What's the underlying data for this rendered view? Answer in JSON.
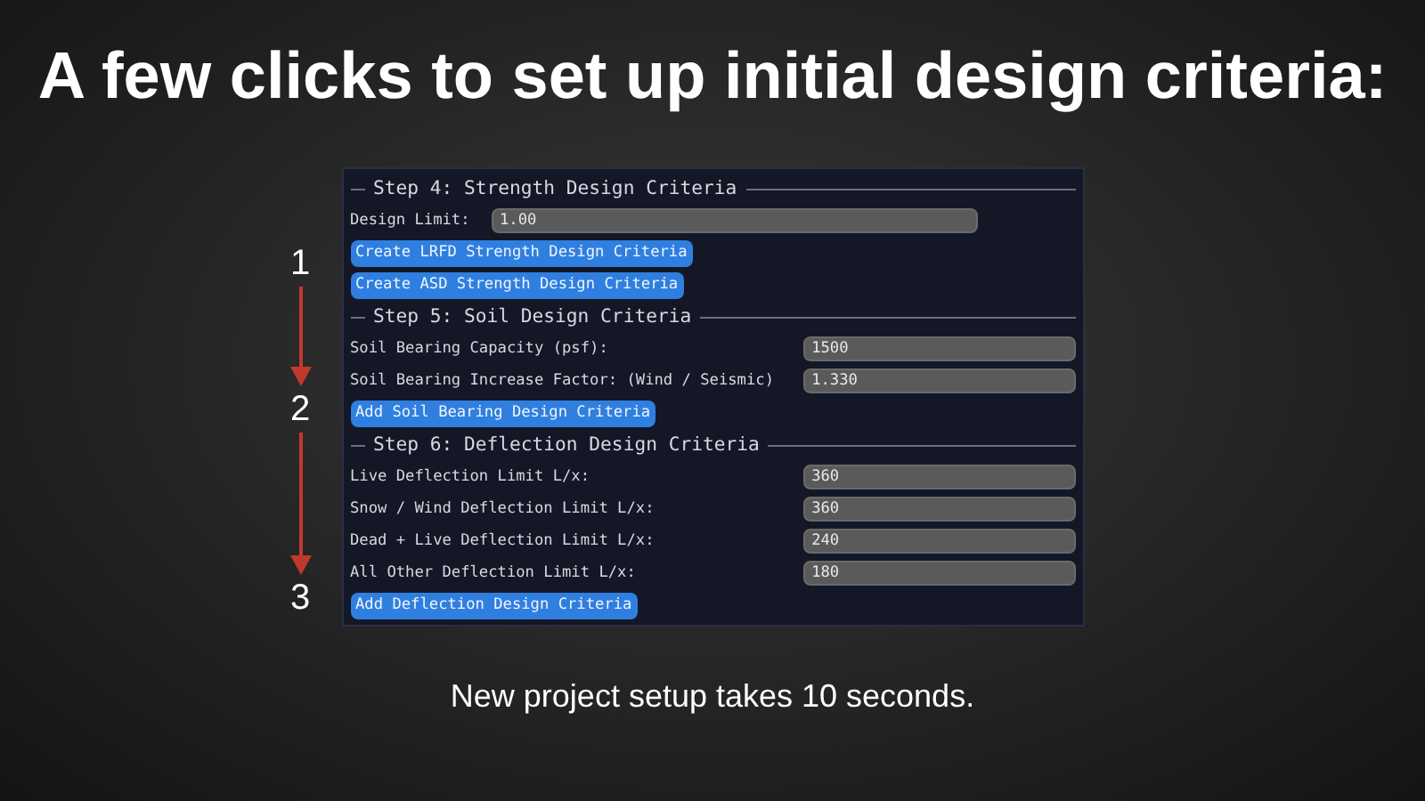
{
  "title": "A few clicks to set up initial design criteria:",
  "markers": [
    {
      "label": "1"
    },
    {
      "label": "2"
    },
    {
      "label": "3"
    }
  ],
  "panel": {
    "sections": [
      {
        "heading": "Step 4: Strength Design Criteria",
        "fields": [
          {
            "kind": "inline",
            "label": "Design Limit:",
            "value": "1.00"
          }
        ],
        "buttons": [
          "Create LRFD Strength Design Criteria",
          "Create ASD Strength Design Criteria"
        ]
      },
      {
        "heading": "Step 5: Soil Design Criteria",
        "fields": [
          {
            "kind": "aligned",
            "label": "Soil Bearing Capacity (psf):",
            "value": "1500"
          },
          {
            "kind": "aligned",
            "label": "Soil Bearing Increase Factor: (Wind / Seismic)",
            "value": "1.330"
          }
        ],
        "buttons": [
          "Add Soil Bearing Design Criteria"
        ]
      },
      {
        "heading": "Step 6: Deflection Design Criteria",
        "fields": [
          {
            "kind": "aligned",
            "label": "Live Deflection Limit L/x:",
            "value": "360"
          },
          {
            "kind": "aligned",
            "label": "Snow / Wind Deflection Limit L/x:",
            "value": "360"
          },
          {
            "kind": "aligned",
            "label": "Dead + Live Deflection Limit L/x:",
            "value": "240"
          },
          {
            "kind": "aligned",
            "label": "All Other Deflection Limit L/x:",
            "value": "180"
          }
        ],
        "buttons": [
          "Add Deflection Design Criteria"
        ]
      }
    ]
  },
  "caption": "New project setup takes 10 seconds."
}
